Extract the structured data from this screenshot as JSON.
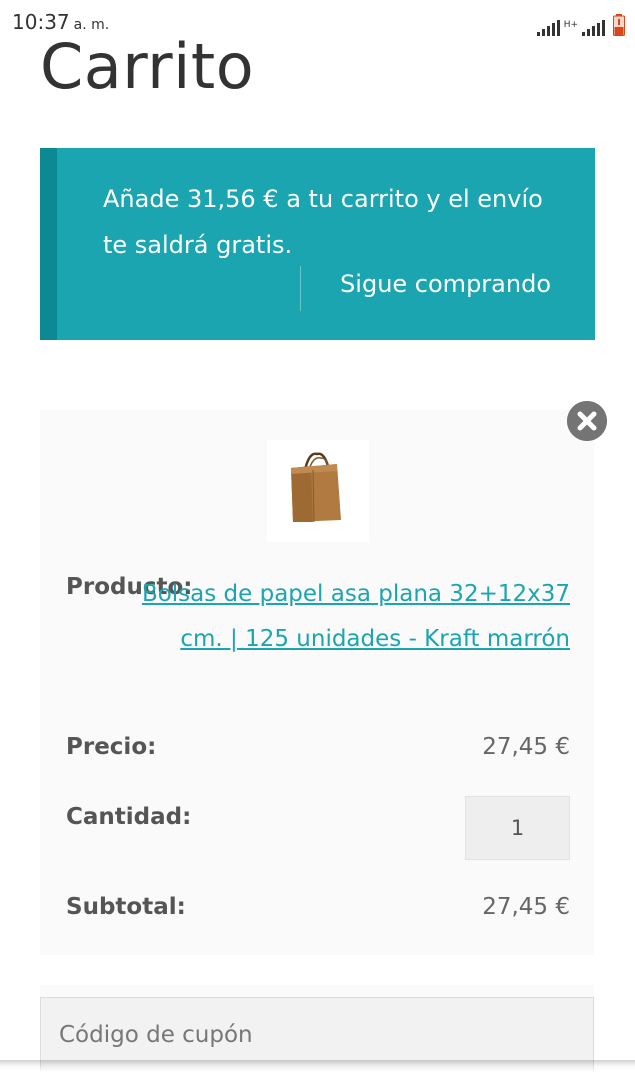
{
  "status_bar": {
    "time": "10:37",
    "ampm": "a. m.",
    "network_label": "H+",
    "icons": [
      "signal-icon",
      "signal-icon",
      "battery-icon"
    ]
  },
  "page": {
    "title": "Carrito"
  },
  "banner": {
    "message": "Añade 31,56 € a tu carrito y el envío te saldrá gratis.",
    "link_label": "Sigue comprando",
    "bg_color": "#1aa5b0",
    "accent_color": "#0b8a93"
  },
  "cart_item": {
    "remove_icon": "close-circle-icon",
    "thumbnail_icon": "paper-bag-image",
    "product_label": "Producto:",
    "product_name": "Bolsas de papel asa plana 32+12x37 cm. | 125 unidades - Kraft marrón",
    "price_label": "Precio:",
    "price_value": "27,45 €",
    "quantity_label": "Cantidad:",
    "quantity_value": "1",
    "subtotal_label": "Subtotal:",
    "subtotal_value": "27,45 €"
  },
  "coupon": {
    "placeholder": "Código de cupón"
  }
}
